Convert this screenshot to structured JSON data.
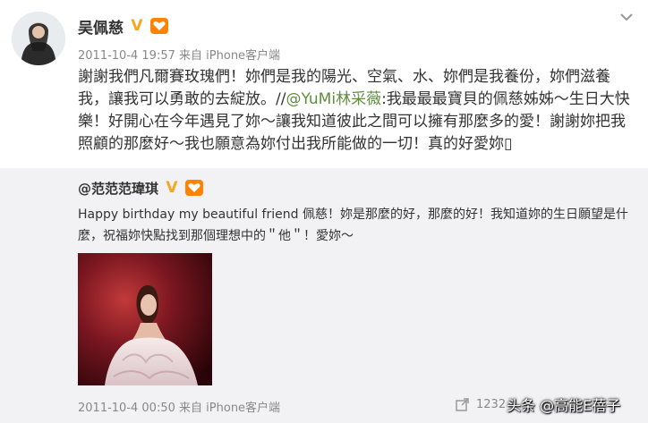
{
  "post": {
    "author": "吴佩慈",
    "time": "2011-10-4 19:57",
    "source_prefix": "来自",
    "source": "iPhone客户端",
    "text_before_mention": "謝謝我們凡爾賽玫瑰們！妳們是我的陽光、空氣、水、妳們是我養份，妳們滋養我，讓我可以勇敢的去綻放。//",
    "mention": "@YuMi林采薇",
    "text_after_mention": ":我最最最寶貝的佩慈姊姊～生日大快樂！好開心在今年遇見了妳～讓我知道彼此之間可以擁有那麼多的愛！謝謝妳把我照顧的那麼好～我也願意為妳付出我所能做的一切！真的好愛妳▯"
  },
  "repost": {
    "author": "@范范范瑋琪",
    "text": "Happy birthday my beautiful friend 佩慈！妳是那麼的好，那麼的好！我知道妳的生日願望是什麼，祝福妳快點找到那個理想中的＂他＂！愛妳～",
    "time": "2011-10-4 00:50",
    "source_prefix": "来自",
    "source": "iPhone客户端",
    "repost_count": "1232"
  },
  "watermark": "头条 @高能E蓓子",
  "colors": {
    "accent_link": "#5e8f3e",
    "repost_bg": "#f2f2f5",
    "meta_gray": "#888888",
    "badge_orange": "#ff8200",
    "v_badge": "#f6a623"
  },
  "icons": [
    "avatar",
    "verified-v-icon",
    "member-badge-icon",
    "chevron-down-icon",
    "share-icon"
  ]
}
